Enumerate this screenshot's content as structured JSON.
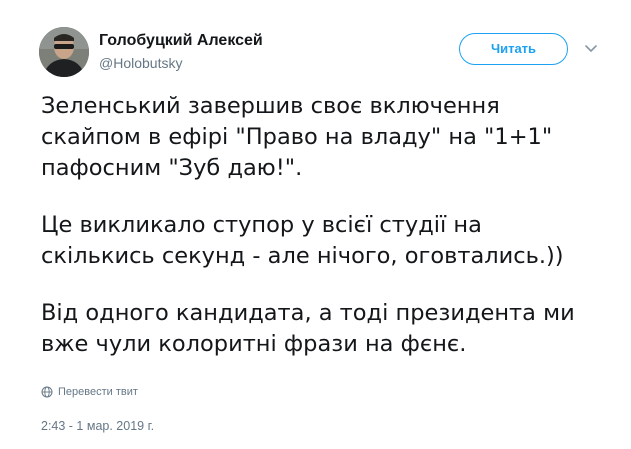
{
  "author": {
    "name": "Голобуцкий Алексей",
    "handle": "@Holobutsky"
  },
  "follow_button": {
    "label": "Читать"
  },
  "tweet": {
    "paragraphs": [
      "Зеленський завершив своє включення\nскайпом в ефірі \"Право на владу\" на \"1+1\"\nпафосним \"Зуб даю!\".",
      "Це викликало ступор у всієї студії на\nскількись секунд - але нічого, оговтались.))",
      "Від одного кандидата, а тоді президента ми\nвже чули колоритні фрази на фєнє."
    ],
    "translate_label": "Перевести твит",
    "timestamp": "2:43 - 1 мар. 2019 г."
  },
  "colors": {
    "accent": "#1da1f2",
    "text": "#14171a",
    "secondary": "#657786"
  },
  "icons": {
    "translate": "globe-icon",
    "menu": "chevron-down-icon"
  }
}
